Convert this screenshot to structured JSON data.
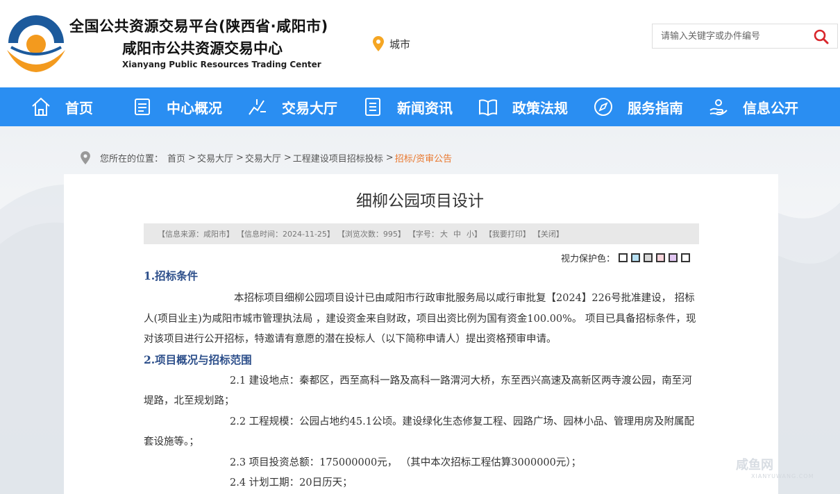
{
  "header": {
    "title_line1": "全国公共资源交易平台(陕西省·咸阳市)",
    "title_line2": "咸阳市公共资源交易中心",
    "title_en": "Xianyang Public Resources Trading Center",
    "city_label": "城市",
    "search_placeholder": "请输入关键字或办件编号"
  },
  "nav": {
    "items": [
      {
        "label": "首页",
        "icon": "home-icon"
      },
      {
        "label": "中心概况",
        "icon": "document-icon"
      },
      {
        "label": "交易大厅",
        "icon": "chart-icon"
      },
      {
        "label": "新闻资讯",
        "icon": "list-icon"
      },
      {
        "label": "政策法规",
        "icon": "book-icon"
      },
      {
        "label": "服务指南",
        "icon": "compass-icon"
      },
      {
        "label": "信息公开",
        "icon": "hand-icon"
      }
    ]
  },
  "breadcrumb": {
    "prefix": "您所在的位置：",
    "items": [
      "首页",
      "交易大厅",
      "交易大厅",
      "工程建设项目招标投标"
    ],
    "current": "招标/资审公告"
  },
  "article": {
    "title": "细柳公园项目设计",
    "meta": {
      "source": "【信息来源：咸阳市】",
      "time": "【信息时间：2024-11-25】",
      "views": "【浏览次数：995】",
      "font_prefix": "【字号：",
      "font_large": "大",
      "font_medium": "中",
      "font_small": "小",
      "font_suffix": "】",
      "print": "【我要打印】",
      "close": "【关闭】"
    },
    "vision_label": "视力保护色：",
    "vision_colors": [
      "#ffffff",
      "#b6e0f3",
      "#d8d8d8",
      "#f8d5dc",
      "#e1c6f1",
      "#ffffff"
    ],
    "section1_heading": "1.招标条件",
    "section1_text": "本招标项目细柳公园项目设计已由咸阳市行政审批服务局以咸行审批复【2024】226号批准建设， 招标人(项目业主)为咸阳市城市管理执法局 ，建设资金来自财政，项目出资比例为国有资金100.00%。 项目已具备招标条件，现对该项目进行公开招标，特邀请有意愿的潜在投标人（以下简称申请人）提出资格预审申请。",
    "section2_heading": "2.项目概况与招标范围",
    "items": [
      "2.1 建设地点：秦都区，西至高科一路及高科一路渭河大桥，东至西兴高速及高新区两寺渡公园，南至河堤路，北至规划路；",
      "2.2 工程规模：公园占地约45.1公顷。建设绿化生态修复工程、园路广场、园林小品、管理用房及附属配套设施等。；",
      "2.3 项目投资总额：175000000元， （其中本次招标工程估算3000000元）；",
      "2.4 计划工期：20日历天；"
    ]
  },
  "watermark": {
    "text": "咸鱼网",
    "sub": "XIANYUWANG.COM"
  },
  "colors": {
    "nav_bg": "#2a8ef2",
    "logo_blue": "#1c5a9c",
    "logo_orange": "#f39a1e",
    "accent_orange": "#e9772d",
    "heading_blue": "#2c4e8a",
    "search_red": "#d8262b"
  }
}
